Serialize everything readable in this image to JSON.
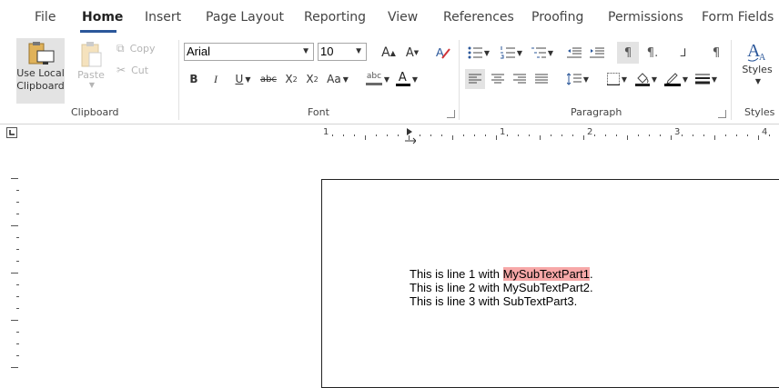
{
  "tabs": [
    {
      "label": "File"
    },
    {
      "label": "Home"
    },
    {
      "label": "Insert"
    },
    {
      "label": "Page Layout"
    },
    {
      "label": "Reporting"
    },
    {
      "label": "View"
    },
    {
      "label": "References"
    },
    {
      "label": "Proofing"
    },
    {
      "label": "Permissions"
    },
    {
      "label": "Form Fields"
    }
  ],
  "clipboard": {
    "use_local_line1": "Use Local",
    "use_local_line2": "Clipboard",
    "paste_label": "Paste",
    "copy_label": "Copy",
    "cut_label": "Cut",
    "group_label": "Clipboard"
  },
  "font": {
    "family": "Arial",
    "size": "10",
    "group_label": "Font",
    "bold": "B",
    "italic": "I",
    "underline": "U",
    "strike": "abc",
    "subscript": "X",
    "sub_mark": "2",
    "superscript": "X",
    "sup_mark": "2",
    "change_case": "Aa",
    "grow": "A",
    "shrink": "A",
    "font_color": "A",
    "highlight_mark": "abc"
  },
  "paragraph": {
    "group_label": "Paragraph"
  },
  "styles": {
    "label": "Styles",
    "group_label": "Styles"
  },
  "ruler": {
    "numbers": [
      "1",
      "1",
      "2",
      "3",
      "4"
    ]
  },
  "document": {
    "line1_prefix": "This is line 1 with ",
    "line1_highlight": "MySubTextPart1",
    "line1_suffix": ".",
    "line2": "This is line 2 with MySubTextPart2.",
    "line3": "This is line 3 with SubTextPart3."
  },
  "colors": {
    "accent": "#2b579a",
    "highlight": "#f7a8a8",
    "styles_icon": "#2b579a"
  }
}
